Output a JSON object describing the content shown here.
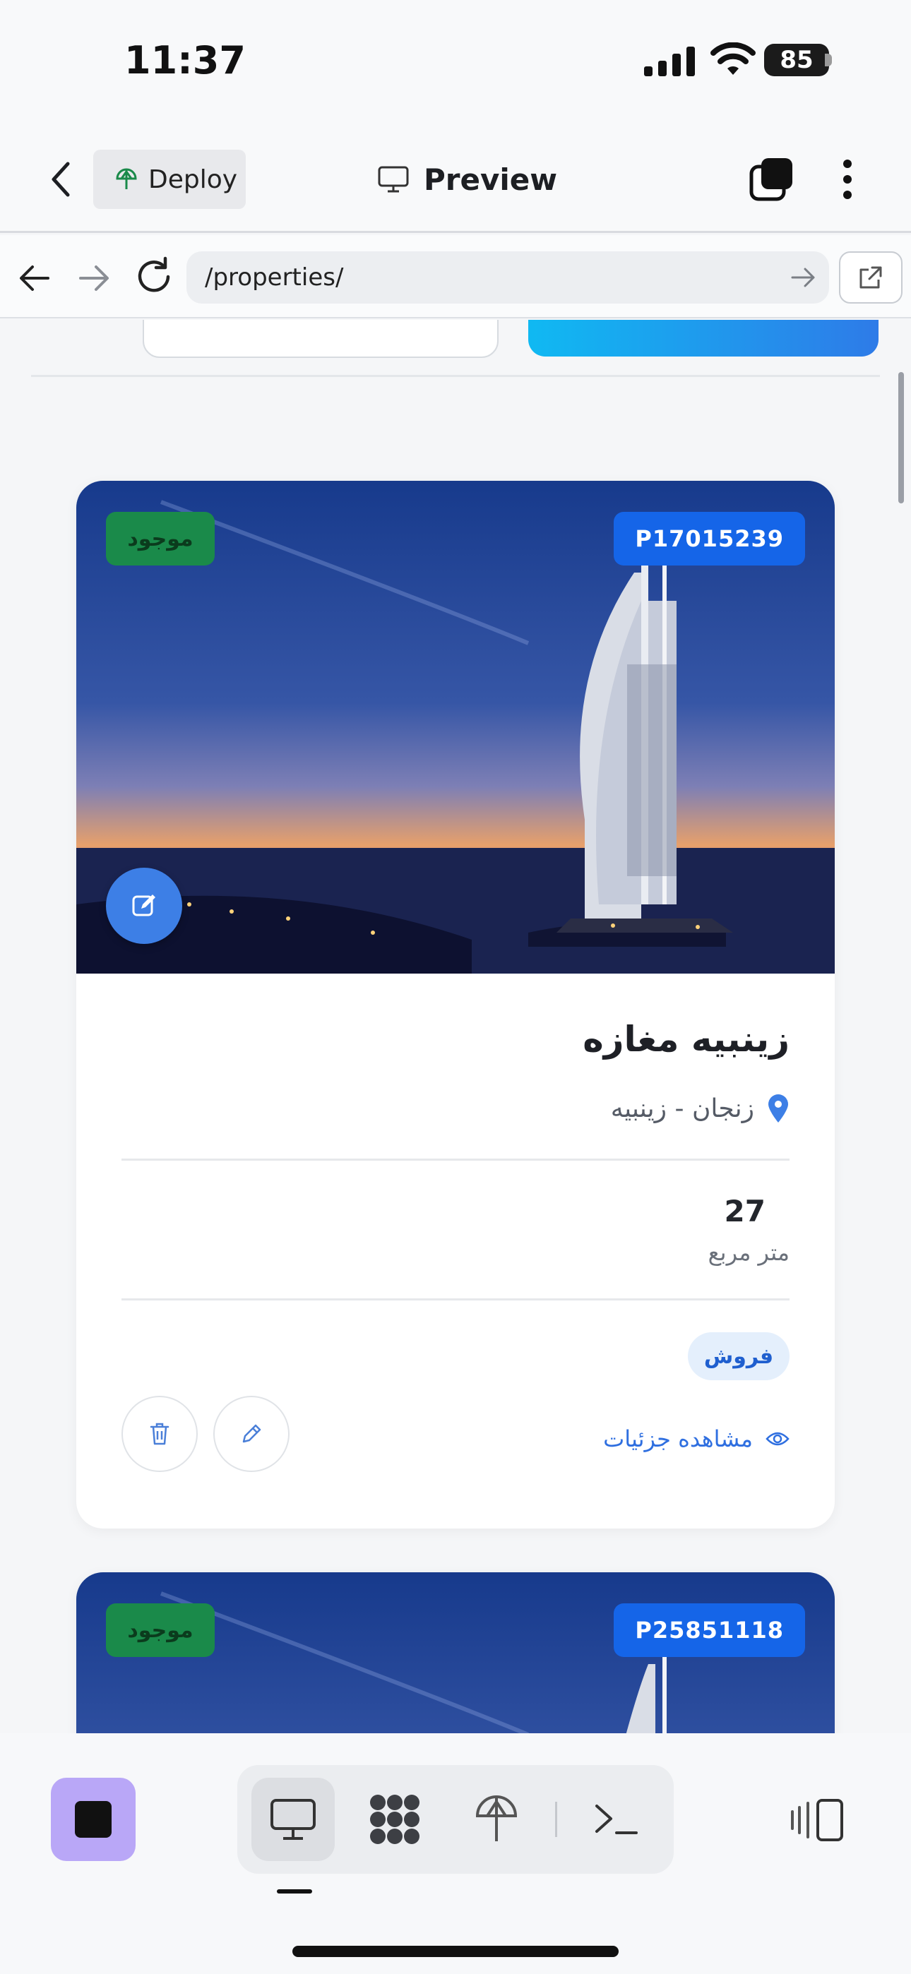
{
  "status": {
    "time": "11:37",
    "battery": "85"
  },
  "topbar": {
    "deploy_label": "Deploy",
    "title": "Preview"
  },
  "browser": {
    "url": "/properties/"
  },
  "listings": [
    {
      "status_badge": "موجود",
      "code": "P17015239",
      "title": "زینبیه مغازه",
      "location": "زنجان - زینبیه",
      "area_value": "27",
      "area_unit": "متر مربع",
      "deal_type": "فروش",
      "view_details": "مشاهده جزئیات"
    },
    {
      "status_badge": "موجود",
      "code": "P25851118"
    }
  ],
  "colors": {
    "accent_blue": "#1565e8",
    "available_green": "#1a8a4a",
    "stop_purple": "#b9a7f7"
  }
}
